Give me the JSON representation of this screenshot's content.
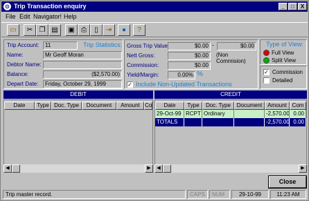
{
  "window": {
    "title": "Trip Transaction enquiry",
    "controls": [
      "_",
      "□",
      "X"
    ]
  },
  "menu": [
    "File",
    "Edit",
    "Navigator!",
    "Help"
  ],
  "toolbar_icons": [
    "folder-open-icon",
    "cut-icon",
    "copy-icon",
    "paste-icon",
    "printer-icon",
    "print-icon",
    "print-preview-icon",
    "exit-icon",
    "globe-icon",
    "help-icon"
  ],
  "info": {
    "trip_account_label": "Trip Account:",
    "trip_account_value": "11",
    "trip_statistics_label": "Trip Statistics:",
    "name_label": "Name:",
    "name_value": "Mr Geoff Moran",
    "debtor_name_label": "Debtor Name:",
    "debtor_name_value": "",
    "balance_label": "Balance:",
    "balance_value": "($2,570.00)",
    "depart_date_label": "Depart Date:",
    "depart_date_value": "Friday, October 29, 1999"
  },
  "stats": {
    "gross_trip_value_label": "Gross Trip Value:",
    "gross_trip_value": "$0.00",
    "dash": "-",
    "non_commission_value": "$0.00",
    "non_commission_label": "(Non Commision)",
    "nett_gross_label": "Nett Gross:",
    "nett_gross_value": "$0.00",
    "commission_label": "Commission:",
    "commission_value": "$0.00",
    "yield_label": "Yield/Margin:",
    "yield_value": "0.00%",
    "yield_unit": "%",
    "include_label": "Include Non-Updated Transactions",
    "include_checked": "✓"
  },
  "view": {
    "type_label": "Type of View:",
    "full_view_label": "Full View",
    "split_view_label": "Split View",
    "commission_label": "Commission",
    "commission_checked": "✓",
    "detailed_label": "Detailed",
    "detailed_checked": ""
  },
  "debit": {
    "title": "DEBIT",
    "columns": [
      "Date",
      "Type",
      "Doc. Type",
      "Document",
      "Amount",
      "Co"
    ]
  },
  "credit": {
    "title": "CREDIT",
    "columns": [
      "Date",
      "Type",
      "Doc. Type",
      "Document",
      "Amount",
      "Com"
    ],
    "rows": [
      [
        "29-Oct-99",
        "RCPT",
        "Ordinary",
        "",
        "-2,570.00",
        "0.00"
      ]
    ],
    "totals": [
      "TOTALS",
      "",
      "",
      "",
      "-2,570.00",
      "0.00"
    ]
  },
  "buttons": {
    "close": "Close"
  },
  "status": {
    "message": "Trip master record.",
    "caps": "CAPS",
    "num": "NUM",
    "date": "29-10-99",
    "time": "11:23 AM"
  },
  "colors": {
    "title_bar": "#000080",
    "label_blue": "#000080",
    "accent_blue": "#1e7fd0",
    "row_highlight": "#c8f0c8",
    "totals_row": "#000080",
    "full_view_radio": "#e00000",
    "split_view_radio": "#00b000"
  }
}
